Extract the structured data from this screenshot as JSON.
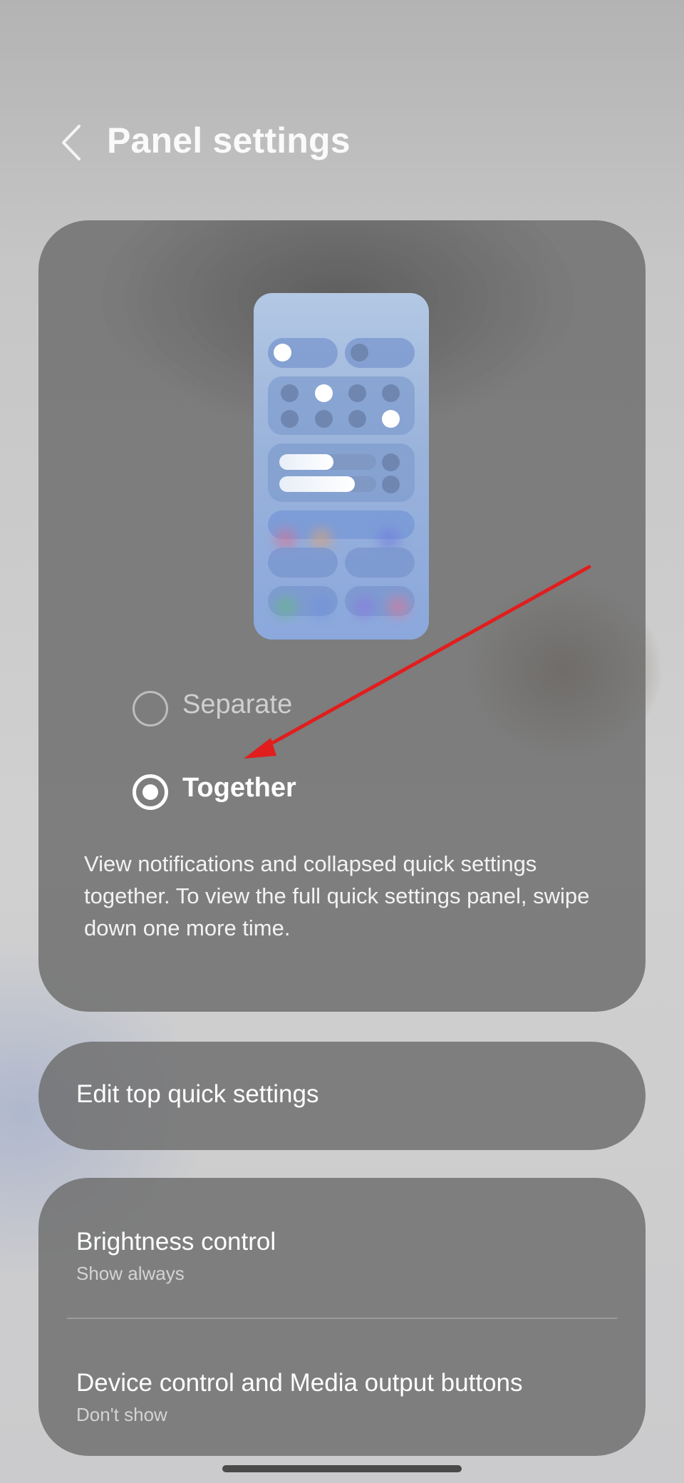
{
  "header": {
    "title": "Panel settings",
    "back_icon": "chevron-left-icon"
  },
  "panel_mode": {
    "options": [
      {
        "label": "Separate",
        "selected": false
      },
      {
        "label": "Together",
        "selected": true
      }
    ],
    "description": "View notifications and collapsed quick settings together. To view the full quick settings panel, swipe down one more time."
  },
  "edit_quick_settings": {
    "label": "Edit top quick settings"
  },
  "settings_list": [
    {
      "title": "Brightness control",
      "subtitle": "Show always"
    },
    {
      "title": "Device control and Media output buttons",
      "subtitle": "Don't show"
    }
  ],
  "colors": {
    "annotation_arrow": "#e01e1e",
    "accent": "#ffffff"
  }
}
